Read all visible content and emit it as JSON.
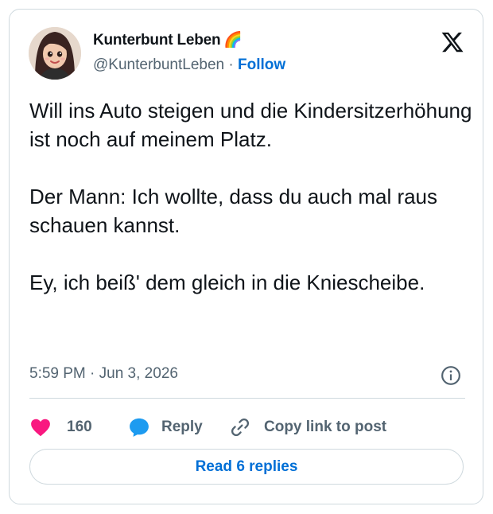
{
  "author": {
    "display_name": "Kunterbunt Leben",
    "name_emoji": "🌈",
    "handle": "@KunterbuntLeben",
    "separator": "·",
    "follow_label": "Follow"
  },
  "tweet": {
    "text": "Will ins Auto steigen und die Kindersitzerhöhung ist noch auf meinem Platz.\n\nDer Mann: Ich wollte, dass du auch mal raus schauen kannst.\n\nEy, ich beiß' dem gleich in die Kniescheibe.",
    "timestamp": "5:59 PM · Jun 3, 2026"
  },
  "actions": {
    "like_count": "160",
    "reply_label": "Reply",
    "copy_label": "Copy link to post"
  },
  "footer": {
    "read_replies_label": "Read 6 replies"
  },
  "colors": {
    "like_pink": "#f91880",
    "reply_blue": "#1d9bf0",
    "link_blue": "#006fd6",
    "secondary_text": "#536471",
    "border": "#cfd9de"
  },
  "icons": [
    "avatar",
    "x-logo-icon",
    "info-icon",
    "heart-icon",
    "reply-bubble-icon",
    "link-icon"
  ]
}
